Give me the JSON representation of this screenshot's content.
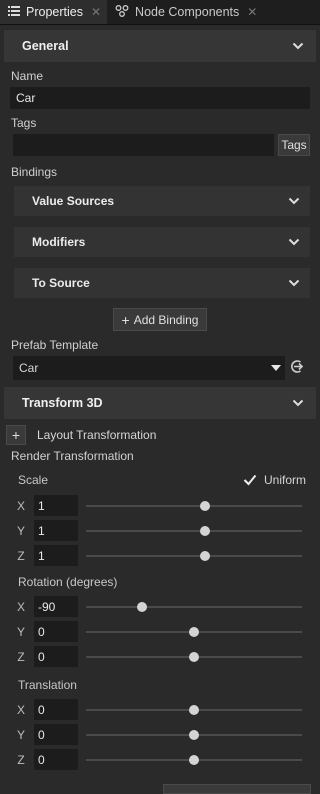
{
  "tabs": [
    {
      "label": "Properties",
      "close": "✕"
    },
    {
      "label": "Node Components",
      "close": "✕"
    }
  ],
  "general": {
    "title": "General"
  },
  "name": {
    "label": "Name",
    "value": "Car"
  },
  "tags": {
    "label": "Tags",
    "value": "",
    "button": "Tags"
  },
  "bindings": {
    "label": "Bindings",
    "items": [
      "Value Sources",
      "Modifiers",
      "To Source"
    ],
    "add_button": "Add Binding",
    "add_icon": "+"
  },
  "prefab": {
    "label": "Prefab Template",
    "value": "Car"
  },
  "transform": {
    "title": "Transform 3D"
  },
  "layout_transformation": {
    "label": "Layout Transformation",
    "icon": "+"
  },
  "render_transformation": {
    "label": "Render Transformation"
  },
  "scale": {
    "label": "Scale",
    "uniform_label": "Uniform",
    "uniform_checked": true,
    "rows": [
      {
        "axis": "X",
        "value": "1",
        "level": 0.55
      },
      {
        "axis": "Y",
        "value": "1",
        "level": 0.55
      },
      {
        "axis": "Z",
        "value": "1",
        "level": 0.55
      }
    ]
  },
  "rotation": {
    "label": "Rotation (degrees)",
    "rows": [
      {
        "axis": "X",
        "value": "-90",
        "level": 0.26
      },
      {
        "axis": "Y",
        "value": "0",
        "level": 0.5
      },
      {
        "axis": "Z",
        "value": "0",
        "level": 0.5
      }
    ]
  },
  "translation": {
    "label": "Translation",
    "rows": [
      {
        "axis": "X",
        "value": "0",
        "level": 0.5
      },
      {
        "axis": "Y",
        "value": "0",
        "level": 0.5
      },
      {
        "axis": "Z",
        "value": "0",
        "level": 0.5
      }
    ]
  }
}
